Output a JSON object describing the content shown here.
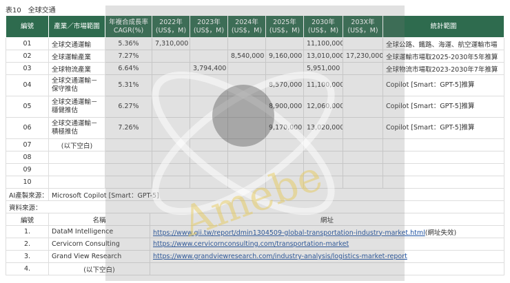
{
  "caption": "表10　全球交通",
  "headers": [
    "編號",
    "產業／市場範圍",
    "年複合成長率\nCAGR(%)",
    "2022年\n(US$，M)",
    "2023年\n(US$，M)",
    "2024年\n(US$，M)",
    "2025年\n(US$，M)",
    "2030年\n(US$，M)",
    "203X年\n(US$，M)",
    "統計範圍"
  ],
  "rows": [
    [
      "01",
      "全球交通運輸",
      "5.36%",
      "7,310,000",
      "",
      "",
      "",
      "11,100,000",
      "",
      "全球公路、鐵路、海運、航空運輸市場"
    ],
    [
      "02",
      "全球運輸產業",
      "7.27%",
      "",
      "",
      "8,540,000",
      "9,160,000",
      "13,010,000",
      "17,230,000",
      "全球運輸市場取2025-2030年5年推算"
    ],
    [
      "03",
      "全球物流產業",
      "6.64%",
      "",
      "3,794,400",
      "",
      "",
      "5,951,000",
      "",
      "全球物流市場取2023-2030年7年推算"
    ],
    [
      "04",
      "全球交通運輸－保守推估",
      "5.31%",
      "",
      "",
      "",
      "8,570,000",
      "11,100,000",
      "",
      "Copilot [Smart：GPT-5]推算"
    ],
    [
      "05",
      "全球交通運輸－穩健推估",
      "6.27%",
      "",
      "",
      "",
      "8,900,000",
      "12,060,000",
      "",
      "Copilot [Smart：GPT-5]推算"
    ],
    [
      "06",
      "全球交通運輸－積極推估",
      "7.26%",
      "",
      "",
      "",
      "9,170,000",
      "13,020,000",
      "",
      "Copilot [Smart：GPT-5]推算"
    ],
    [
      "07",
      "(以下空白)",
      "",
      "",
      "",
      "",
      "",
      "",
      "",
      ""
    ],
    [
      "08",
      "",
      "",
      "",
      "",
      "",
      "",
      "",
      "",
      ""
    ],
    [
      "09",
      "",
      "",
      "",
      "",
      "",
      "",
      "",
      "",
      ""
    ],
    [
      "10",
      "",
      "",
      "",
      "",
      "",
      "",
      "",
      "",
      ""
    ]
  ],
  "ai_label": "AI產製來源：",
  "ai_value": "Microsoft Copilot [Smart：GPT-5]",
  "sources_label": "資料來源：",
  "source_headers": [
    "編號",
    "名稱",
    "網址"
  ],
  "sources": [
    {
      "no": "1.",
      "name": "DataM Intelligence",
      "url": "https://www.gii.tw/report/dmin1304509-global-transportation-industry-market.html",
      "note": "(網址失效)"
    },
    {
      "no": "2.",
      "name": "Cervicorn Consulting",
      "url": "https://www.cervicornconsulting.com/transportation-market",
      "note": ""
    },
    {
      "no": "3.",
      "name": "Grand View Research",
      "url": "https://www.grandviewresearch.com/industry-analysis/logistics-market-report",
      "note": ""
    },
    {
      "no": "4.",
      "name": "(以下空白)",
      "url": "",
      "note": ""
    }
  ]
}
